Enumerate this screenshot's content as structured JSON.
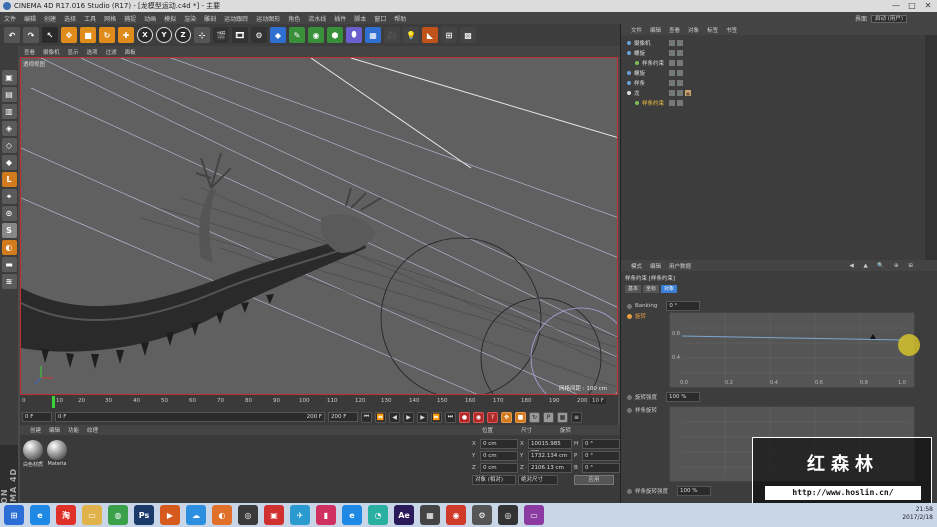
{
  "window": {
    "title": "CINEMA 4D R17.016 Studio (R17) - [龙模型运动.c4d *] - 主要",
    "buttons": [
      "—",
      "□",
      "✕"
    ]
  },
  "menubar": {
    "items": [
      "文件",
      "编辑",
      "创建",
      "选择",
      "工具",
      "网格",
      "捕捉",
      "动画",
      "模拟",
      "渲染",
      "雕刻",
      "运动跟踪",
      "运动图形",
      "角色",
      "流水线",
      "插件",
      "脚本",
      "窗口",
      "帮助"
    ],
    "layout_label": "界面",
    "layout_value": "启动 (用户)"
  },
  "toolbar": {
    "axis_x": "X",
    "axis_y": "Y",
    "axis_z": "Z"
  },
  "viewport": {
    "menu": [
      "查看",
      "摄像机",
      "显示",
      "选项",
      "过滤",
      "面板"
    ],
    "label": "透视视图",
    "grid_info": "网格间距 : 100 cm"
  },
  "timeline": {
    "ticks": [
      "0",
      "10",
      "20",
      "30",
      "40",
      "50",
      "60",
      "70",
      "80",
      "90",
      "100",
      "110",
      "120",
      "130",
      "140",
      "150",
      "160",
      "170",
      "180",
      "190",
      "200"
    ],
    "end_frame": "10 F"
  },
  "playbar": {
    "start": "0 F",
    "current": "0 F",
    "range_end": "200 F",
    "max": "200 F"
  },
  "materials": {
    "menu": [
      "创建",
      "编辑",
      "功能",
      "纹理"
    ],
    "items": [
      "白色材质",
      "Materia"
    ]
  },
  "coordinates": {
    "headers": [
      "位置",
      "尺寸",
      "旋转"
    ],
    "rows": [
      {
        "axis": "X",
        "pos": "0 cm",
        "size_axis": "X",
        "size": "10015.985 cm",
        "rot_axis": "H",
        "rot": "0 °"
      },
      {
        "axis": "Y",
        "pos": "0 cm",
        "size_axis": "Y",
        "size": "1732.134 cm",
        "rot_axis": "P",
        "rot": "0 °"
      },
      {
        "axis": "Z",
        "pos": "0 cm",
        "size_axis": "Z",
        "size": "2106.13 cm",
        "rot_axis": "B",
        "rot": "0 °"
      }
    ],
    "mode_select": "对象 (相对)",
    "size_select": "绝对尺寸",
    "apply": "应用"
  },
  "object_manager": {
    "menu": [
      "文件",
      "编辑",
      "查看",
      "对象",
      "标签",
      "书签"
    ],
    "objects": [
      {
        "name": "摄像机",
        "indent": 0,
        "active": false
      },
      {
        "name": "螺旋",
        "indent": 0,
        "active": false
      },
      {
        "name": "样条约束",
        "indent": 1,
        "active": false
      },
      {
        "name": "螺旋",
        "indent": 0,
        "active": false
      },
      {
        "name": "样条",
        "indent": 0,
        "active": false
      },
      {
        "name": "龙",
        "indent": 0,
        "active": false
      },
      {
        "name": "样条约束",
        "indent": 1,
        "active": true
      }
    ]
  },
  "attribute_manager": {
    "menu": [
      "模式",
      "编辑",
      "用户数据"
    ],
    "title": "样条约束 [样条约束]",
    "tabs": [
      "基本",
      "坐标",
      "对象"
    ],
    "active_tab": 2,
    "banking_label": "Banking",
    "banking_value": "0 °",
    "rotation_label": "旋转",
    "rotation_strength_label": "旋转强度",
    "rotation_strength_value": "100 %",
    "spline_rotation_label": "样条旋转",
    "spline_rotation_strength_label": "样条旋转强度",
    "spline_rotation_strength_value": "100 %",
    "graph_y_labels": [
      "0.8",
      "0.4"
    ],
    "graph_x_labels": [
      "0.0",
      "0.2",
      "0.4",
      "0.6",
      "0.8",
      "1.0"
    ]
  },
  "watermark": {
    "name": "红森林",
    "url": "http://www.hoslin.cn/"
  },
  "taskbar": {
    "time": "21:58",
    "date": "2017/2/18"
  },
  "colors": {
    "accent": "#3a7fd5",
    "viewport_border": "#c03030",
    "timeline_marker": "#3bd13b"
  }
}
